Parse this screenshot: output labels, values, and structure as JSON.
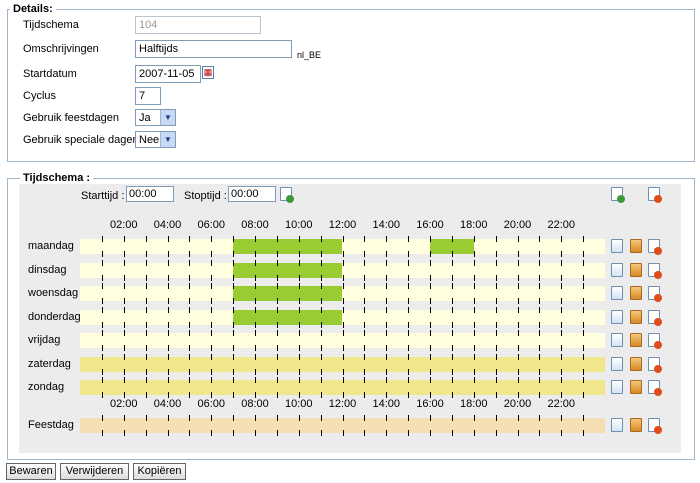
{
  "details": {
    "legend": "Details:",
    "schedule_label": "Tijdschema",
    "schedule_value": "104",
    "description_label": "Omschrijvingen",
    "description_value": "Halftijds",
    "locale": "nl_BE",
    "startdate_label": "Startdatum",
    "startdate_value": "2007-11-05",
    "cycle_label": "Cyclus",
    "cycle_value": "7",
    "holidays_label": "Gebruik feestdagen",
    "holidays_value": "Ja",
    "special_days_label": "Gebruik speciale dagen",
    "special_days_value": "Nee"
  },
  "schedule": {
    "legend": "Tijdschema :",
    "start_label": "Starttijd :",
    "start_value": "00:00",
    "stop_label": "Stoptijd :",
    "stop_value": "00:00",
    "hour_labels": [
      "02:00",
      "04:00",
      "06:00",
      "08:00",
      "10:00",
      "12:00",
      "14:00",
      "16:00",
      "18:00",
      "20:00",
      "22:00"
    ],
    "days": [
      {
        "name": "maandag",
        "weekend": false,
        "blocks": [
          [
            7,
            12
          ],
          [
            16,
            18
          ]
        ]
      },
      {
        "name": "dinsdag",
        "weekend": false,
        "blocks": [
          [
            7,
            12
          ]
        ]
      },
      {
        "name": "woensdag",
        "weekend": false,
        "blocks": [
          [
            7,
            12
          ]
        ]
      },
      {
        "name": "donderdag",
        "weekend": false,
        "blocks": [
          [
            7,
            12
          ]
        ]
      },
      {
        "name": "vrijdag",
        "weekend": false,
        "blocks": []
      },
      {
        "name": "zaterdag",
        "weekend": true,
        "blocks": []
      },
      {
        "name": "zondag",
        "weekend": true,
        "blocks": []
      }
    ],
    "holiday_label": "Feestdag",
    "colors": {
      "workday": "#ffffe0",
      "weekend": "#f0e68c",
      "holiday": "#f5deb3",
      "worked": "#99cc33"
    }
  },
  "buttons": {
    "save": "Bewaren",
    "delete": "Verwijderen",
    "copy": "Kopiëren"
  }
}
